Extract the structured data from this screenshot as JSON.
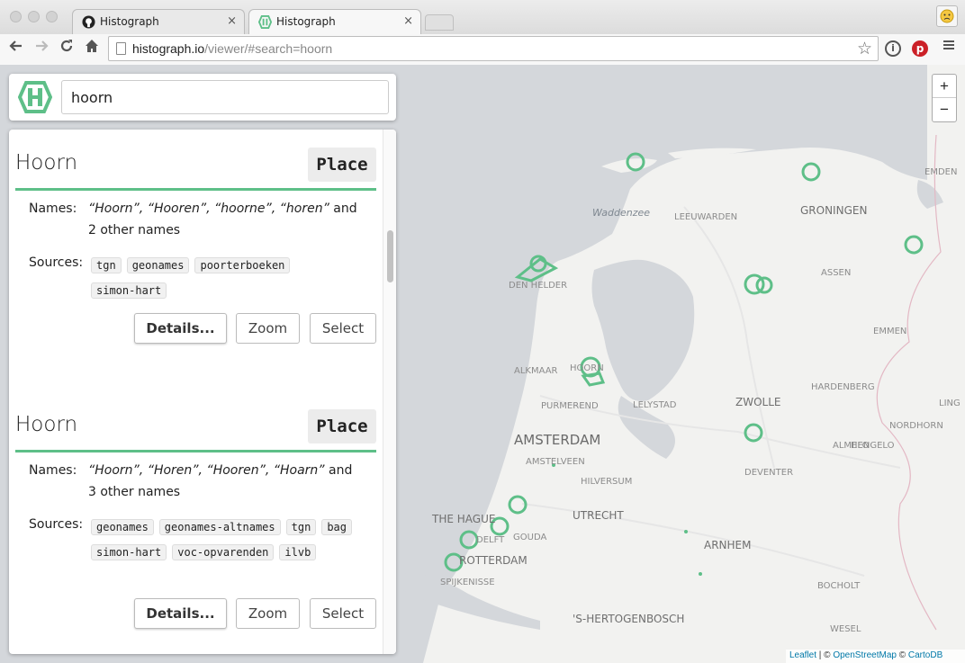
{
  "browser": {
    "tabs": [
      {
        "title": "Histograph",
        "icon": "github-icon"
      },
      {
        "title": "Histograph",
        "icon": "histograph-icon"
      }
    ],
    "url_host": "histograph.io",
    "url_path": "/viewer/#search=hoorn",
    "close_glyph": "×"
  },
  "search": {
    "value": "hoorn"
  },
  "map": {
    "zoom_in": "+",
    "zoom_out": "−",
    "labels": [
      {
        "text": "Waddenzee",
        "style": "water"
      },
      {
        "text": "LEEUWARDEN",
        "style": "town"
      },
      {
        "text": "GRONINGEN",
        "style": "city"
      },
      {
        "text": "EMDEN",
        "style": "town"
      },
      {
        "text": "ASSEN",
        "style": "town"
      },
      {
        "text": "DEN HELDER",
        "style": "town"
      },
      {
        "text": "EMMEN",
        "style": "town"
      },
      {
        "text": "ALKMAAR",
        "style": "town"
      },
      {
        "text": "HOORN",
        "style": "town"
      },
      {
        "text": "HARDENBERG",
        "style": "town"
      },
      {
        "text": "PURMEREND",
        "style": "town"
      },
      {
        "text": "LELYSTAD",
        "style": "town"
      },
      {
        "text": "ZWOLLE",
        "style": "city"
      },
      {
        "text": "LING",
        "style": "town"
      },
      {
        "text": "NORDHORN",
        "style": "town"
      },
      {
        "text": "AMSTERDAM",
        "style": "big"
      },
      {
        "text": "AMSTELVEEN",
        "style": "town"
      },
      {
        "text": "ALMELO",
        "style": "town"
      },
      {
        "text": "DEVENTER",
        "style": "town"
      },
      {
        "text": "HENGELO",
        "style": "town"
      },
      {
        "text": "HILVERSUM",
        "style": "town"
      },
      {
        "text": "THE HAGUE",
        "style": "city"
      },
      {
        "text": "UTRECHT",
        "style": "city"
      },
      {
        "text": "DELFT",
        "style": "town"
      },
      {
        "text": "GOUDA",
        "style": "town"
      },
      {
        "text": "ARNHEM",
        "style": "city"
      },
      {
        "text": "ROTTERDAM",
        "style": "city"
      },
      {
        "text": "SPIJKENISSE",
        "style": "town"
      },
      {
        "text": "BOCHOLT",
        "style": "town"
      },
      {
        "text": "'S-HERTOGENBOSCH",
        "style": "city"
      },
      {
        "text": "WESEL",
        "style": "town"
      }
    ],
    "attribution": {
      "leaflet": "Leaflet",
      "sep1": " | © ",
      "osm": "OpenStreetMap",
      "sep2": " © ",
      "carto": "CartoDB"
    }
  },
  "results": [
    {
      "title": "Hoorn",
      "type": "Place",
      "names_label": "Names:",
      "names_italic": "“Hoorn”, “Hooren”, “hoorne”, “horen”",
      "names_rest": " and 2 other names",
      "sources_label": "Sources:",
      "sources": [
        "tgn",
        "geonames",
        "poorterboeken",
        "simon-hart"
      ],
      "buttons": {
        "details": "Details...",
        "zoom": "Zoom",
        "select": "Select"
      }
    },
    {
      "title": "Hoorn",
      "type": "Place",
      "names_label": "Names:",
      "names_italic": "“Hoorn”, “Horen”, “Hooren”, “Hoarn”",
      "names_rest": " and 3 other names",
      "sources_label": "Sources:",
      "sources": [
        "geonames",
        "geonames-altnames",
        "tgn",
        "bag",
        "simon-hart",
        "voc-opvarenden",
        "ilvb"
      ],
      "buttons": {
        "details": "Details...",
        "zoom": "Zoom",
        "select": "Select"
      }
    }
  ],
  "colors": {
    "accent": "#5ebf88",
    "water": "#d3d6da",
    "land": "#f2f2f0"
  }
}
